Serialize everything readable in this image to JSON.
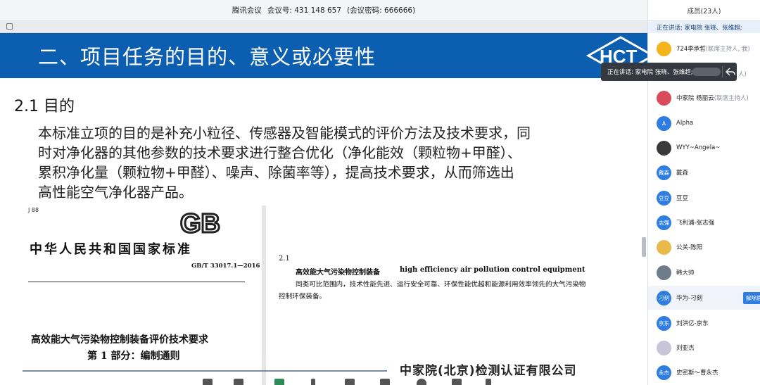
{
  "topbar": {
    "app": "腾讯会议",
    "meeting_id": "会议号: 431 148 657",
    "password": "(会议密码: 666666)"
  },
  "slide": {
    "title": "二、项目任务的目的、意义或必要性",
    "logo_text": "HCT",
    "heading": "2.1 目的",
    "paragraph": [
      "本标准立项的目的是补充小粒径、传感器及智能模式的评价方法及技术要求，同",
      "时对净化器的其他参数的技术要求进行整合优化（净化能效（颗粒物+甲醛）、",
      "累积净化量（颗粒物+甲醛）、噪声、除菌率等），提高技术要求，从而筛选出",
      "高性能空气净化器产品。"
    ],
    "doc_left": {
      "code": "J 88",
      "gb_logo": "GB",
      "standard_name": "中华人民共和国国家标准",
      "standard_no": "GB/T 33017.1—2016",
      "title_line1": "高效能大气污染物控制装备评价技术要求",
      "title_line2": "第 1 部分：编制通则"
    },
    "doc_right": {
      "clause": "2.1",
      "term_cn": "高效能大气污染物控制装备",
      "term_en": "high efficiency air pollution control equipment",
      "definition_line1": "同类可比范围内，技术性能先进、运行安全可靠、环保性能优越和能源利用效率领先的大气污染物",
      "definition_line2": "控制环保装备。",
      "company": "中家院(北京)检测认证有限公司"
    }
  },
  "panel": {
    "title": "成员(23人)",
    "speaking": "正在讲话: 家电院 张晓、张维超;",
    "members": [
      {
        "name": "724李承哲",
        "role": "(联席主持人, 我)",
        "avatar": "",
        "color": "#f3b51b"
      },
      {
        "name": "中家院 杨丽云",
        "role": "(联席主持人)",
        "avatar": "",
        "color": "#d94b5a"
      },
      {
        "name": "Alpha",
        "role": "",
        "avatar": "A",
        "color": "#2f7de1"
      },
      {
        "name": "WYY~Angela~",
        "role": "",
        "avatar": "",
        "color": "#3a3a3a"
      },
      {
        "name": "戴森",
        "role": "",
        "avatar": "戴森",
        "color": "#2f7de1"
      },
      {
        "name": "豆豆",
        "role": "",
        "avatar": "豆豆",
        "color": "#2f7de1"
      },
      {
        "name": "飞利浦-张志强",
        "role": "",
        "avatar": "志强",
        "color": "#2f7de1"
      },
      {
        "name": "公关-陈阳",
        "role": "",
        "avatar": "",
        "color": "#e9b94a"
      },
      {
        "name": "韩大帅",
        "role": "",
        "avatar": "",
        "color": "#6f7c8a"
      },
      {
        "name": "华为-刁刻",
        "role": "",
        "avatar": "刁刻",
        "color": "#2f7de1",
        "action": "解除静"
      },
      {
        "name": "刘洪亿-京东",
        "role": "",
        "avatar": "京东",
        "color": "#2f7de1"
      },
      {
        "name": "刘亚杰",
        "role": "",
        "avatar": "",
        "color": "#c9c4d8"
      },
      {
        "name": "史密斯～曹永杰",
        "role": "",
        "avatar": "永杰",
        "color": "#2f7de1"
      }
    ],
    "hidden_role": "人)"
  },
  "toast": {
    "text": "正在讲话: 家电院 张晓、张维超;"
  }
}
